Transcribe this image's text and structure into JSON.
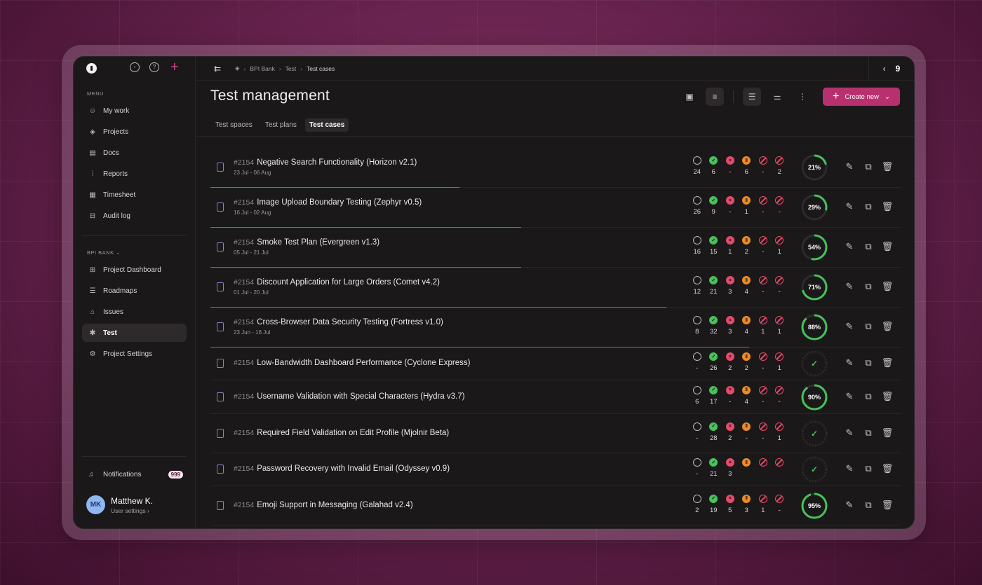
{
  "sidebar": {
    "menu_label": "MENU",
    "menu_items": [
      {
        "label": "My work",
        "icon": "user-icon",
        "glyph": "☺"
      },
      {
        "label": "Projects",
        "icon": "layers-icon",
        "glyph": "◈"
      },
      {
        "label": "Docs",
        "icon": "document-icon",
        "glyph": "▤"
      },
      {
        "label": "Reports",
        "icon": "bar-chart-icon",
        "glyph": "⫶"
      },
      {
        "label": "Timesheet",
        "icon": "calendar-icon",
        "glyph": "▦"
      },
      {
        "label": "Audit log",
        "icon": "audit-icon",
        "glyph": "⊟"
      }
    ],
    "project_label": "BPI BANK",
    "project_items": [
      {
        "label": "Project Dashboard",
        "icon": "grid-icon",
        "glyph": "⊞",
        "active": false
      },
      {
        "label": "Roadmaps",
        "icon": "roadmap-icon",
        "glyph": "☰",
        "active": false
      },
      {
        "label": "Issues",
        "icon": "issues-icon",
        "glyph": "⌂",
        "active": false
      },
      {
        "label": "Test",
        "icon": "test-icon",
        "glyph": "✱",
        "active": true
      },
      {
        "label": "Project Settings",
        "icon": "settings-icon",
        "glyph": "⚙",
        "active": false
      }
    ],
    "notifications_label": "Notifications",
    "notifications_count": "999",
    "user": {
      "initials": "MK",
      "name": "Matthew K.",
      "settings_label": "User settings"
    }
  },
  "topbar": {
    "breadcrumbs": [
      "BPI Bank",
      "Test",
      "Test cases"
    ],
    "page_number": "9"
  },
  "header": {
    "title": "Test management",
    "create_label": "Create new"
  },
  "tabs": [
    {
      "label": "Test spaces",
      "active": false
    },
    {
      "label": "Test plans",
      "active": false
    },
    {
      "label": "Test cases",
      "active": true
    }
  ],
  "colors": {
    "accent": "#b8316e",
    "pass": "#46c25a",
    "fail": "#e84a6a",
    "paused": "#f08a24",
    "progress_line": "#c04f84"
  },
  "test_cases": [
    {
      "id": "#2154",
      "name": "Negative Search Functionality (Horizon v2.1)",
      "dates": "23 Jul - 06 Aug",
      "stats": [
        "24",
        "6",
        "-",
        "6",
        "-",
        "2"
      ],
      "percent": 21,
      "percent_label": "21%",
      "complete": false,
      "progress": 0.36
    },
    {
      "id": "#2154",
      "name": "Image Upload Boundary Testing (Zephyr v0.5)",
      "dates": "16 Jul - 02 Aug",
      "stats": [
        "26",
        "9",
        "-",
        "1",
        "-",
        "-"
      ],
      "percent": 29,
      "percent_label": "29%",
      "complete": false,
      "progress": 0.45
    },
    {
      "id": "#2154",
      "name": "Smoke Test Plan (Evergreen v1.3)",
      "dates": "05 Jul - 21 Jul",
      "stats": [
        "16",
        "15",
        "1",
        "2",
        "-",
        "1"
      ],
      "percent": 54,
      "percent_label": "54%",
      "complete": false,
      "progress": 0.45
    },
    {
      "id": "#2154",
      "name": "Discount Application for Large Orders (Comet v4.2)",
      "dates": "01 Jul - 20 Jul",
      "stats": [
        "12",
        "21",
        "3",
        "4",
        "-",
        "-"
      ],
      "percent": 71,
      "percent_label": "71%",
      "complete": false,
      "progress": 0.66
    },
    {
      "id": "#2154",
      "name": "Cross-Browser Data Security Testing (Fortress v1.0)",
      "dates": "23 Jun - 16 Jul",
      "stats": [
        "8",
        "32",
        "3",
        "4",
        "1",
        "1"
      ],
      "percent": 88,
      "percent_label": "88%",
      "complete": false,
      "progress": 0.78
    },
    {
      "id": "#2154",
      "name": "Low-Bandwidth Dashboard Performance (Cyclone Express)",
      "dates": "",
      "stats": [
        "-",
        "26",
        "2",
        "2",
        "-",
        "1"
      ],
      "percent": 100,
      "percent_label": "",
      "complete": true,
      "progress": 0
    },
    {
      "id": "#2154",
      "name": "Username Validation with Special Characters (Hydra v3.7)",
      "dates": "",
      "stats": [
        "6",
        "17",
        "-",
        "4",
        "-",
        "-"
      ],
      "percent": 90,
      "percent_label": "90%",
      "complete": false,
      "progress": 0
    },
    {
      "id": "#2154",
      "name": "Required Field Validation on Edit Profile (Mjolnir Beta)",
      "dates": "",
      "stats": [
        "-",
        "28",
        "2",
        "-",
        "-",
        "1"
      ],
      "percent": 100,
      "percent_label": "",
      "complete": true,
      "progress": 0
    },
    {
      "id": "#2154",
      "name": "Password Recovery with Invalid Email (Odyssey v0.9)",
      "dates": "",
      "stats": [
        "-",
        "21",
        "3",
        "",
        "",
        ""
      ],
      "percent": 100,
      "percent_label": "",
      "complete": true,
      "progress": 0
    },
    {
      "id": "#2154",
      "name": "Emoji Support in Messaging (Galahad v2.4)",
      "dates": "",
      "stats": [
        "2",
        "19",
        "5",
        "3",
        "1",
        "-"
      ],
      "percent": 95,
      "percent_label": "95%",
      "complete": false,
      "progress": 0
    }
  ]
}
